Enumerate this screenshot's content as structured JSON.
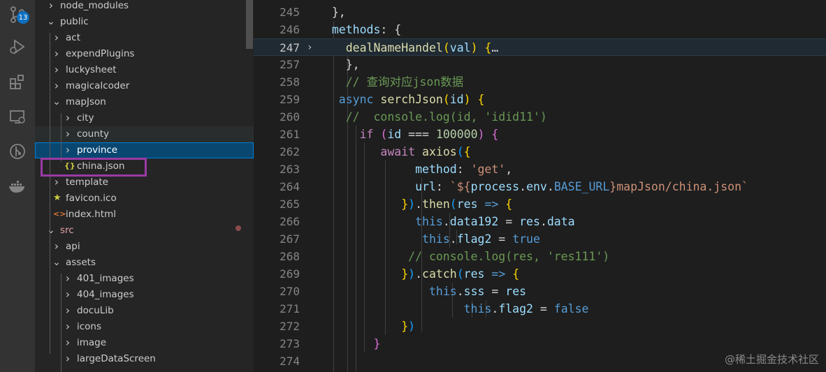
{
  "activity_bar": {
    "scm_badge": "13",
    "icons": [
      "source-control-icon",
      "run-debug-icon",
      "extensions-icon",
      "remote-explorer-icon",
      "git-graph-icon",
      "docker-icon"
    ]
  },
  "explorer": {
    "items": [
      {
        "label": "node_modules",
        "depth": 1,
        "type": "folder",
        "open": false
      },
      {
        "label": "public",
        "depth": 1,
        "type": "folder",
        "open": true
      },
      {
        "label": "act",
        "depth": 2,
        "type": "folder",
        "open": false
      },
      {
        "label": "expendPlugins",
        "depth": 2,
        "type": "folder",
        "open": false
      },
      {
        "label": "luckysheet",
        "depth": 2,
        "type": "folder",
        "open": false
      },
      {
        "label": "magicalcoder",
        "depth": 2,
        "type": "folder",
        "open": false
      },
      {
        "label": "mapJson",
        "depth": 2,
        "type": "folder",
        "open": true
      },
      {
        "label": "city",
        "depth": 3,
        "type": "folder",
        "open": false
      },
      {
        "label": "county",
        "depth": 3,
        "type": "folder",
        "open": false
      },
      {
        "label": "province",
        "depth": 3,
        "type": "folder",
        "open": false,
        "selected": true
      },
      {
        "label": "china.json",
        "depth": 3,
        "type": "json"
      },
      {
        "label": "template",
        "depth": 2,
        "type": "folder",
        "open": false
      },
      {
        "label": "favicon.ico",
        "depth": 2,
        "type": "ico"
      },
      {
        "label": "index.html",
        "depth": 2,
        "type": "html"
      },
      {
        "label": "src",
        "depth": 1,
        "type": "folder",
        "open": true,
        "modified": true
      },
      {
        "label": "api",
        "depth": 2,
        "type": "folder",
        "open": false
      },
      {
        "label": "assets",
        "depth": 2,
        "type": "folder",
        "open": true
      },
      {
        "label": "401_images",
        "depth": 3,
        "type": "folder",
        "open": false
      },
      {
        "label": "404_images",
        "depth": 3,
        "type": "folder",
        "open": false
      },
      {
        "label": "docuLib",
        "depth": 3,
        "type": "folder",
        "open": false
      },
      {
        "label": "icons",
        "depth": 3,
        "type": "folder",
        "open": false
      },
      {
        "label": "image",
        "depth": 3,
        "type": "folder",
        "open": false
      },
      {
        "label": "largeDataScreen",
        "depth": 3,
        "type": "folder",
        "open": false
      }
    ]
  },
  "editor": {
    "active_line": "247",
    "lines": [
      {
        "n": "245",
        "tokens": [
          [
            "p",
            "  },"
          ]
        ]
      },
      {
        "n": "246",
        "tokens": [
          [
            "v",
            "  methods"
          ],
          [
            "p",
            ": {"
          ]
        ]
      },
      {
        "n": "247",
        "fold": "›",
        "tokens": [
          [
            "p",
            "    "
          ],
          [
            "f",
            "dealNameHandel"
          ],
          [
            "y",
            "("
          ],
          [
            "v",
            "val"
          ],
          [
            "y",
            ")"
          ],
          [
            "p",
            " "
          ],
          [
            "y",
            "{"
          ],
          [
            "p",
            "…"
          ]
        ]
      },
      {
        "n": "257",
        "tokens": [
          [
            "p",
            "    },"
          ]
        ]
      },
      {
        "n": "258",
        "tokens": [
          [
            "cm",
            "    // 查询对应json数据"
          ]
        ]
      },
      {
        "n": "259",
        "tokens": [
          [
            "k",
            "   async "
          ],
          [
            "f",
            "serchJson"
          ],
          [
            "y",
            "("
          ],
          [
            "v",
            "id"
          ],
          [
            "y",
            ")"
          ],
          [
            "p",
            " "
          ],
          [
            "y",
            "{"
          ]
        ]
      },
      {
        "n": "260",
        "tokens": [
          [
            "cm",
            "    //  console.log(id, 'idid11')"
          ]
        ]
      },
      {
        "n": "261",
        "tokens": [
          [
            "p",
            "      "
          ],
          [
            "c",
            "if"
          ],
          [
            "p",
            " "
          ],
          [
            "pk",
            "("
          ],
          [
            "v",
            "id"
          ],
          [
            "p",
            " === "
          ],
          [
            "n",
            "100000"
          ],
          [
            "pk",
            ")"
          ],
          [
            "p",
            " "
          ],
          [
            "pk",
            "{"
          ]
        ]
      },
      {
        "n": "262",
        "tokens": [
          [
            "p",
            "         "
          ],
          [
            "c",
            "await"
          ],
          [
            "p",
            " "
          ],
          [
            "f",
            "axios"
          ],
          [
            "bl",
            "("
          ],
          [
            "y",
            "{"
          ]
        ]
      },
      {
        "n": "263",
        "tokens": [
          [
            "p",
            "              "
          ],
          [
            "v",
            "method"
          ],
          [
            "p",
            ": "
          ],
          [
            "s",
            "'get'"
          ],
          [
            "p",
            ","
          ]
        ]
      },
      {
        "n": "264",
        "tokens": [
          [
            "p",
            "              "
          ],
          [
            "v",
            "url"
          ],
          [
            "p",
            ": "
          ],
          [
            "s",
            "`${"
          ],
          [
            "v",
            "process"
          ],
          [
            "p",
            "."
          ],
          [
            "v",
            "env"
          ],
          [
            "p",
            "."
          ],
          [
            "k",
            "BASE_URL"
          ],
          [
            "s",
            "}mapJson/china.json`"
          ]
        ]
      },
      {
        "n": "265",
        "tokens": [
          [
            "p",
            "            "
          ],
          [
            "y",
            "}"
          ],
          [
            "bl",
            ")"
          ],
          [
            "p",
            "."
          ],
          [
            "f",
            "then"
          ],
          [
            "bl",
            "("
          ],
          [
            "v",
            "res"
          ],
          [
            "p",
            " "
          ],
          [
            "k",
            "=>"
          ],
          [
            "p",
            " "
          ],
          [
            "y",
            "{"
          ]
        ]
      },
      {
        "n": "266",
        "tokens": [
          [
            "p",
            "              "
          ],
          [
            "k",
            "this"
          ],
          [
            "p",
            "."
          ],
          [
            "v",
            "data192"
          ],
          [
            "p",
            " = "
          ],
          [
            "v",
            "res"
          ],
          [
            "p",
            "."
          ],
          [
            "v",
            "data"
          ]
        ]
      },
      {
        "n": "267",
        "tokens": [
          [
            "p",
            "               "
          ],
          [
            "k",
            "this"
          ],
          [
            "p",
            "."
          ],
          [
            "v",
            "flag2"
          ],
          [
            "p",
            " = "
          ],
          [
            "k",
            "true"
          ]
        ]
      },
      {
        "n": "268",
        "tokens": [
          [
            "cm",
            "             // console.log(res, 'res111')"
          ]
        ]
      },
      {
        "n": "269",
        "tokens": [
          [
            "p",
            "            "
          ],
          [
            "y",
            "}"
          ],
          [
            "bl",
            ")"
          ],
          [
            "p",
            "."
          ],
          [
            "f",
            "catch"
          ],
          [
            "bl",
            "("
          ],
          [
            "v",
            "res"
          ],
          [
            "p",
            " "
          ],
          [
            "k",
            "=>"
          ],
          [
            "p",
            " "
          ],
          [
            "y",
            "{"
          ]
        ]
      },
      {
        "n": "270",
        "tokens": [
          [
            "p",
            "                "
          ],
          [
            "k",
            "this"
          ],
          [
            "p",
            "."
          ],
          [
            "v",
            "sss"
          ],
          [
            "p",
            " = "
          ],
          [
            "v",
            "res"
          ]
        ]
      },
      {
        "n": "271",
        "tokens": [
          [
            "p",
            "                     "
          ],
          [
            "k",
            "this"
          ],
          [
            "p",
            "."
          ],
          [
            "v",
            "flag2"
          ],
          [
            "p",
            " = "
          ],
          [
            "k",
            "false"
          ]
        ]
      },
      {
        "n": "272",
        "tokens": [
          [
            "p",
            "            "
          ],
          [
            "y",
            "}"
          ],
          [
            "bl",
            ")"
          ]
        ]
      },
      {
        "n": "273",
        "tokens": [
          [
            "p",
            "        "
          ],
          [
            "pk",
            "}"
          ]
        ]
      },
      {
        "n": "274",
        "tokens": []
      }
    ]
  },
  "watermark": "@稀土掘金技术社区",
  "colors": {
    "selection": "#094771",
    "highlight_box": "#9b3aa5",
    "badge": "#0e70c0"
  }
}
